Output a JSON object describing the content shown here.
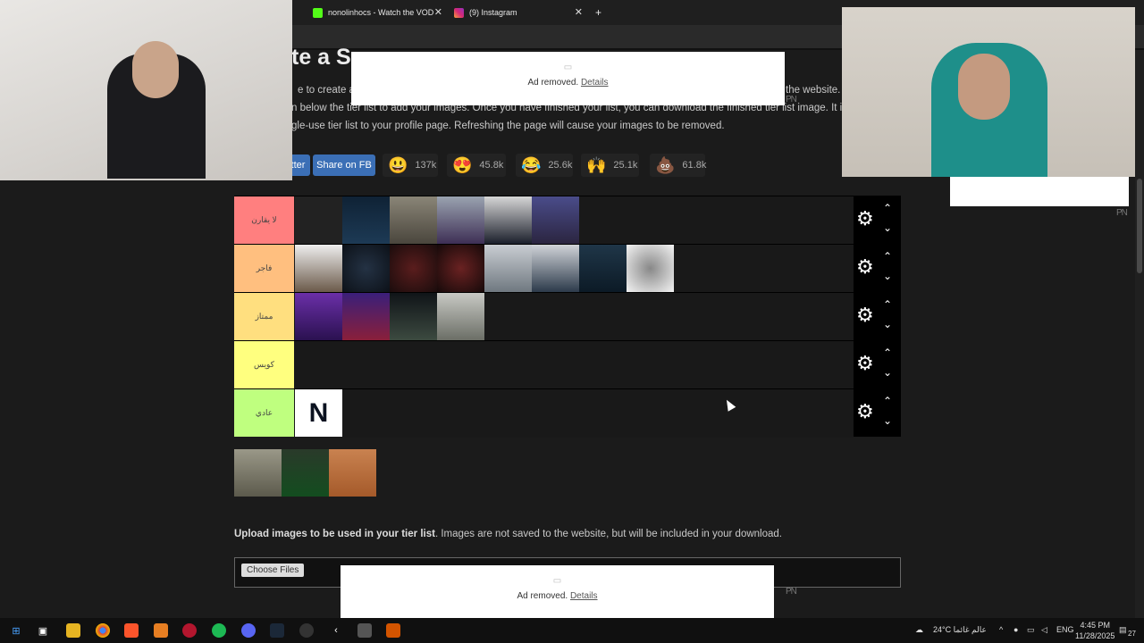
{
  "browser": {
    "tabs": [
      {
        "label": "nonolinhocs - Watch the VOD",
        "icon": "kick-icon"
      },
      {
        "label": "(9) Instagram",
        "icon": "instagram-icon"
      }
    ],
    "new_tab": "+"
  },
  "page": {
    "title_partial": "te a S",
    "intro_lines": [
      "e to create a",
      "n below the tier list to add your images. Once you have finished your list, you can download the finished tier list image. It is",
      "gle-use tier list to your profile page. Refreshing the page will cause your images to be removed."
    ],
    "intro_tail": "the website.",
    "ads": [
      {
        "text": "Ad removed.",
        "link": "Details"
      },
      {
        "text": "Ad removed.",
        "link": "Details"
      }
    ],
    "pn": "PN",
    "share_buttons": [
      "tter",
      "Share on FB"
    ],
    "reactions": [
      {
        "emoji": "😃",
        "count": "137k"
      },
      {
        "emoji": "😍",
        "count": "45.8k"
      },
      {
        "emoji": "😂",
        "count": "25.6k"
      },
      {
        "emoji": "🙌",
        "count": "25.1k"
      },
      {
        "emoji": "💩",
        "count": "61.8k"
      }
    ],
    "tiers": [
      {
        "label": "لا يقارن",
        "color": "#ff7f7f",
        "items": 6
      },
      {
        "label": "فاجر",
        "color": "#ffbf7f",
        "items": 8
      },
      {
        "label": "ممتاز",
        "color": "#ffdf7f",
        "items": 4
      },
      {
        "label": "كويس",
        "color": "#ffff7f",
        "items": 0
      },
      {
        "label": "عادي",
        "color": "#bfff7f",
        "items": 1
      }
    ],
    "upload_bold": "Upload images to be used in your tier list",
    "upload_rest": ". Images are not saved to the website, but will be included in your download.",
    "choose_files": "Choose Files"
  },
  "taskbar": {
    "weather": "24°C عالم غائما",
    "lang": "ENG",
    "time": "4:45 PM",
    "date": "11/28/2025",
    "notifications": "27"
  },
  "colors": {
    "tier_ctrl_bg": "#000000",
    "share_fb": "#3b6fb6"
  }
}
